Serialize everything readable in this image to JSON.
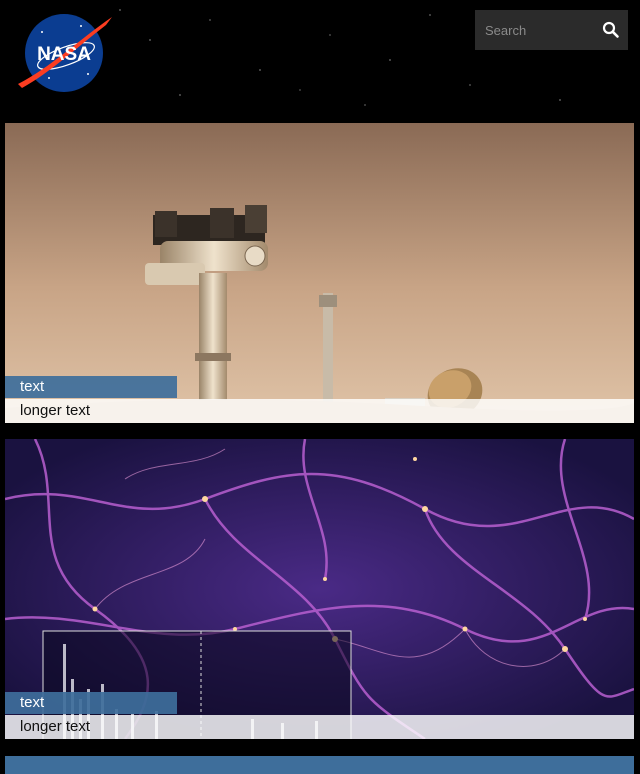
{
  "header": {
    "logo_text": "NASA",
    "search": {
      "placeholder": "Search"
    }
  },
  "cards": [
    {
      "tag": "text",
      "caption": "longer text"
    },
    {
      "tag": "text",
      "caption": "longer text"
    }
  ],
  "colors": {
    "accent": "#3e6e9b",
    "search_bg": "#2b2b2b",
    "page_bg": "#000000"
  },
  "icons": {
    "search": "magnifier-icon",
    "logo": "nasa-meatball-logo"
  }
}
